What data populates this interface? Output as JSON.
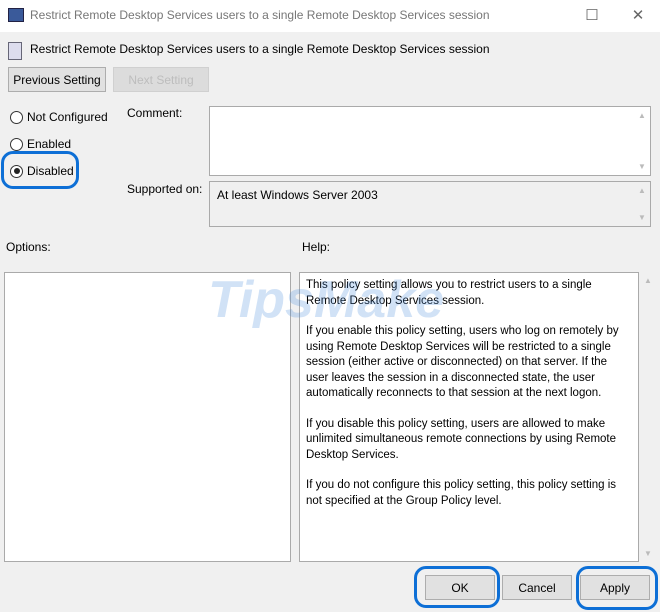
{
  "window": {
    "title": "Restrict Remote Desktop Services users to a single Remote Desktop Services session",
    "maximize_glyph": "☐",
    "close_glyph": "✕"
  },
  "header": {
    "title": "Restrict Remote Desktop Services users to a single Remote Desktop Services session"
  },
  "nav": {
    "previous": "Previous Setting",
    "next": "Next Setting"
  },
  "state": {
    "options": [
      {
        "label": "Not Configured",
        "selected": false
      },
      {
        "label": "Enabled",
        "selected": false
      },
      {
        "label": "Disabled",
        "selected": true
      }
    ]
  },
  "comment": {
    "label": "Comment:",
    "value": ""
  },
  "supported": {
    "label": "Supported on:",
    "value": "At least Windows Server 2003"
  },
  "options_label": "Options:",
  "help": {
    "label": "Help:",
    "paragraphs": [
      "This policy setting allows you to restrict users to a single Remote Desktop Services session.",
      "If you enable this policy setting, users who log on remotely by using Remote Desktop Services will be restricted to a single session (either active or disconnected) on that server. If the user leaves the session in a disconnected state, the user automatically reconnects to that session at the next logon.",
      "If you disable this policy setting, users are allowed to make unlimited simultaneous remote connections by using Remote Desktop Services.",
      "If you do not configure this policy setting,  this policy setting is not specified at the Group Policy level."
    ]
  },
  "footer": {
    "ok": "OK",
    "cancel": "Cancel",
    "apply": "Apply"
  },
  "watermark": "TipsMake.com",
  "colors": {
    "highlight": "#0d6fd6"
  }
}
